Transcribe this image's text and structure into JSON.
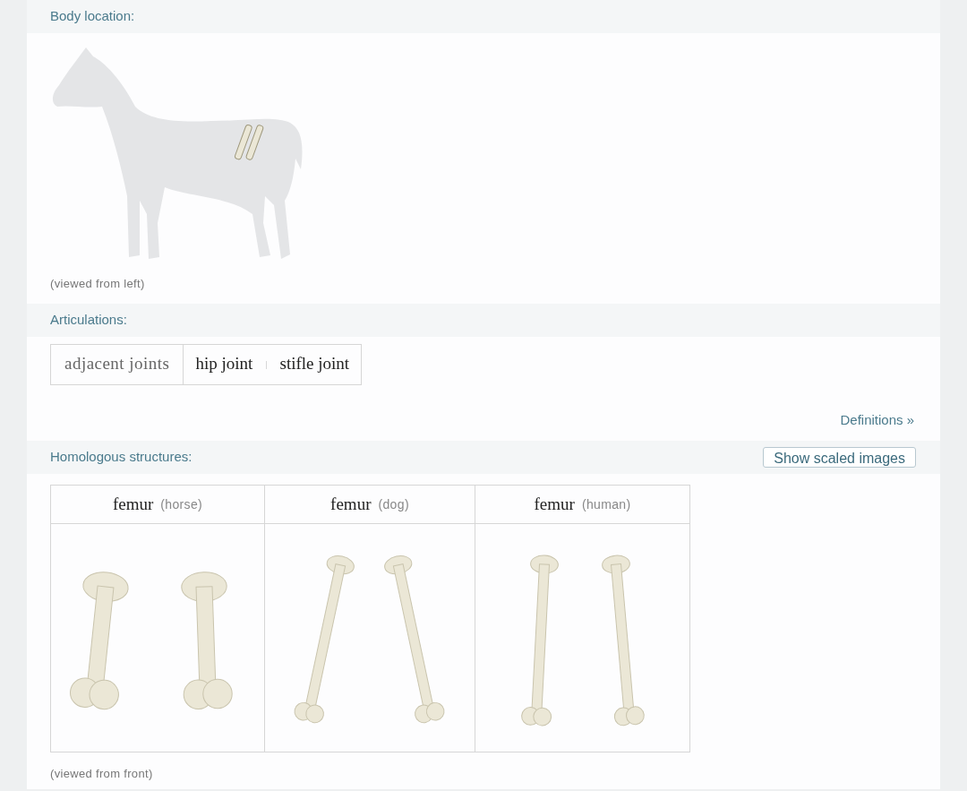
{
  "body_location": {
    "title": "Body location:",
    "caption": "(viewed from left)"
  },
  "articulations": {
    "title": "Articulations:",
    "label": "adjacent joints",
    "joints": [
      "hip joint",
      "stifle joint"
    ],
    "separator": "|",
    "link": "Definitions »"
  },
  "homologous": {
    "title": "Homologous structures:",
    "button": "Show scaled images",
    "items": [
      {
        "name": "femur",
        "species": "(horse)",
        "kind": "stout"
      },
      {
        "name": "femur",
        "species": "(dog)",
        "kind": "slender"
      },
      {
        "name": "femur",
        "species": "(human)",
        "kind": "straight"
      }
    ],
    "caption": "(viewed from front)"
  }
}
